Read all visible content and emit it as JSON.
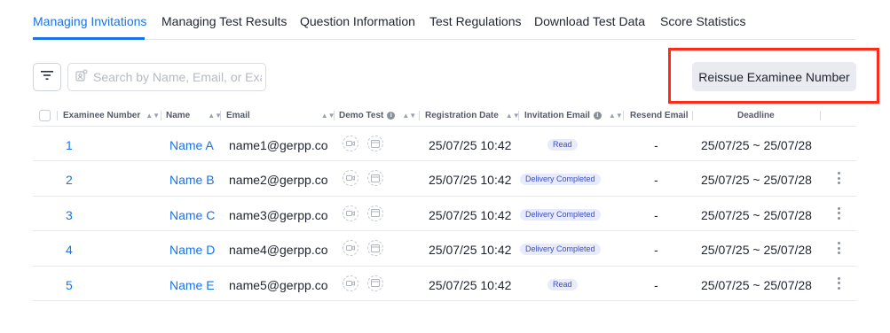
{
  "tabs": [
    {
      "label": "Managing Invitations",
      "active": true
    },
    {
      "label": "Managing Test Results"
    },
    {
      "label": "Question Information"
    },
    {
      "label": "Test Regulations"
    },
    {
      "label": "Download Test Data"
    },
    {
      "label": "Score Statistics"
    }
  ],
  "toolbar": {
    "filter_icon": "filter-icon",
    "search_placeholder": "Search by Name, Email, or Exa",
    "search_value": "",
    "reissue_label": "Reissue Examinee Number"
  },
  "table": {
    "headers": {
      "examinee_number": "Examinee Number",
      "name": "Name",
      "email": "Email",
      "demo_test": "Demo Test",
      "registration_date": "Registration Date",
      "invitation_email": "Invitation Email",
      "resend_email": "Resend Email",
      "deadline": "Deadline"
    },
    "rows": [
      {
        "number": "1",
        "name": "Name A",
        "email": "name1@gerpp.co",
        "registration_date": "25/07/25 10:42",
        "invitation_status": "Read",
        "resend": "-",
        "deadline": "25/07/25 ~ 25/07/28",
        "has_menu": false
      },
      {
        "number": "2",
        "name": "Name B",
        "email": "name2@gerpp.co",
        "registration_date": "25/07/25 10:42",
        "invitation_status": "Delivery Completed",
        "resend": "-",
        "deadline": "25/07/25 ~ 25/07/28",
        "has_menu": true
      },
      {
        "number": "3",
        "name": "Name C",
        "email": "name3@gerpp.co",
        "registration_date": "25/07/25 10:42",
        "invitation_status": "Delivery Completed",
        "resend": "-",
        "deadline": "25/07/25 ~ 25/07/28",
        "has_menu": true
      },
      {
        "number": "4",
        "name": "Name D",
        "email": "name4@gerpp.co",
        "registration_date": "25/07/25 10:42",
        "invitation_status": "Delivery Completed",
        "resend": "-",
        "deadline": "25/07/25 ~ 25/07/28",
        "has_menu": true
      },
      {
        "number": "5",
        "name": "Name E",
        "email": "name5@gerpp.co",
        "registration_date": "25/07/25 10:42",
        "invitation_status": "Read",
        "resend": "-",
        "deadline": "25/07/25 ~ 25/07/28",
        "has_menu": true
      }
    ]
  },
  "colors": {
    "accent": "#1a73e8",
    "highlight": "#ff2a17",
    "badge_bg": "#e8ebfb",
    "badge_text": "#3b4fc4"
  }
}
